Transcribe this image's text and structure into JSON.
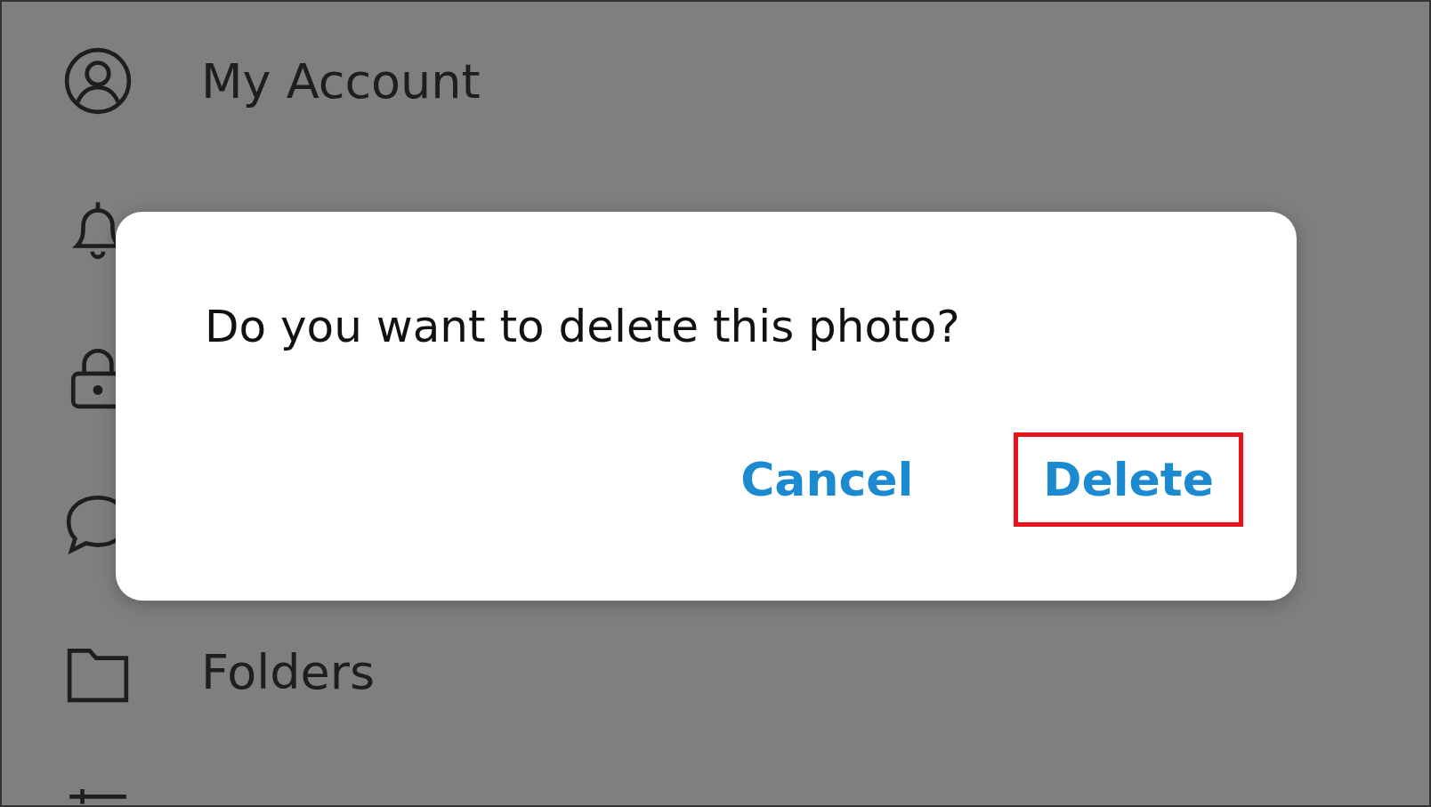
{
  "settings_items": [
    {
      "kind": "account",
      "label": "My Account"
    },
    {
      "kind": "notifications"
    },
    {
      "kind": "privacy"
    },
    {
      "kind": "chats"
    },
    {
      "kind": "folders",
      "label": "Folders"
    },
    {
      "kind": "advanced"
    }
  ],
  "dialog": {
    "message": "Do you want to delete this photo?",
    "buttons": [
      {
        "label": "Cancel",
        "highlighted": false
      },
      {
        "label": "Delete",
        "highlighted": true
      }
    ]
  }
}
